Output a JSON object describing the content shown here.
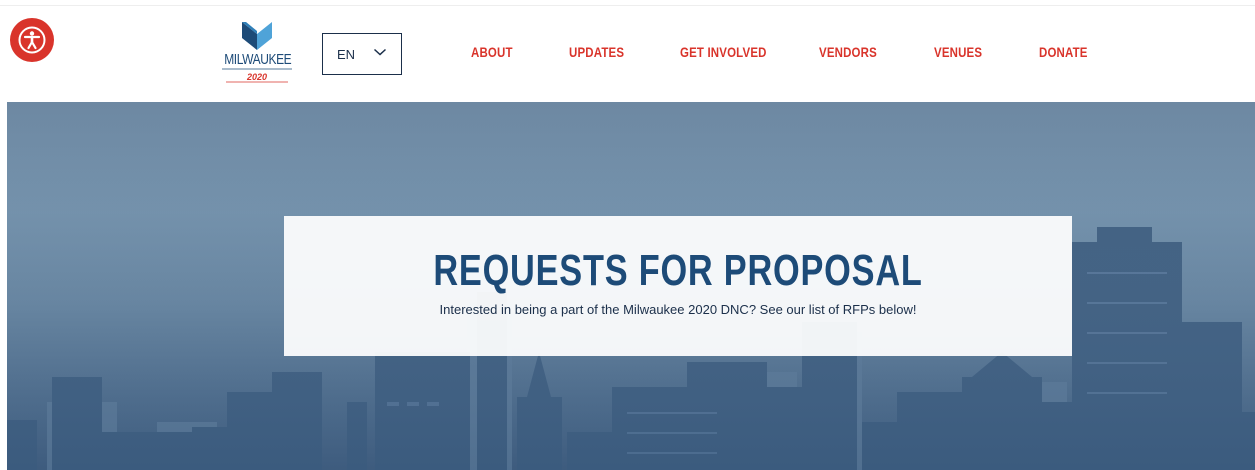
{
  "accessibility": {
    "icon": "accessibility-icon",
    "color": "#d9342b"
  },
  "logo": {
    "text": "MILWAUKEE",
    "year": "2020",
    "icon": "m-logo-icon"
  },
  "language": {
    "value": "EN",
    "icon": "chevron-down-icon"
  },
  "nav": {
    "items": [
      {
        "label": "ABOUT"
      },
      {
        "label": "UPDATES"
      },
      {
        "label": "GET INVOLVED"
      },
      {
        "label": "VENDORS"
      },
      {
        "label": "VENUES"
      },
      {
        "label": "DONATE"
      }
    ],
    "color": "#d9342b"
  },
  "hero": {
    "title": "REQUESTS FOR PROPOSAL",
    "subtitle": "Interested in being a part of the Milwaukee 2020 DNC? See our list of RFPs below!"
  },
  "colors": {
    "brand_blue": "#1d4b78",
    "accent_red": "#d9342b",
    "dark_text": "#1b2f4a"
  }
}
